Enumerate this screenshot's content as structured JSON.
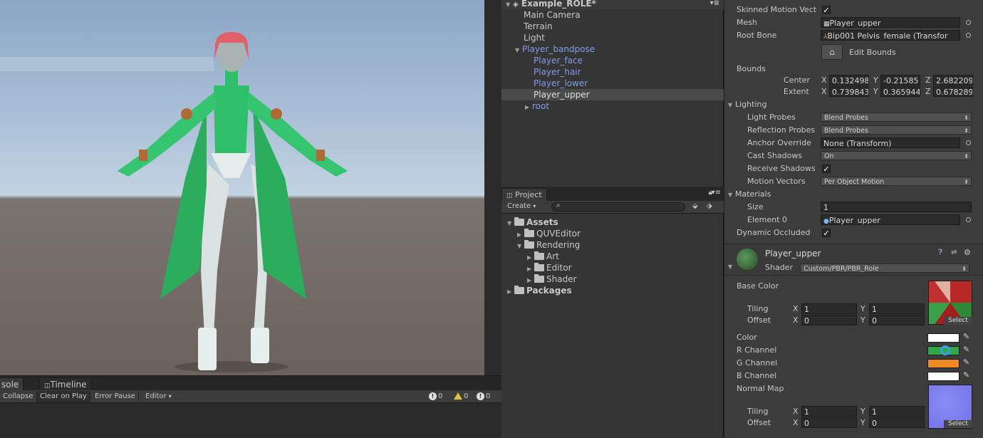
{
  "console": {
    "tab_console": "sole",
    "tab_timeline": "Timeline",
    "btn_collapse": "Collapse",
    "btn_clear_on_play": "Clear on Play",
    "btn_error_pause": "Error Pause",
    "btn_editor": "Editor",
    "count_info": "0",
    "count_warn": "0",
    "count_error": "0"
  },
  "hierarchy": {
    "scene_name": "Example_ROLE*",
    "items": [
      "Main Camera",
      "Terrain",
      "Light",
      "Player_bandpose",
      "Player_face",
      "Player_hair",
      "Player_lower",
      "Player_upper",
      "root"
    ]
  },
  "project": {
    "tab": "Project",
    "create_label": "Create",
    "tree": [
      "Assets",
      "QUVEditor",
      "Rendering",
      "Art",
      "Editor",
      "Shader",
      "Packages"
    ]
  },
  "inspector": {
    "skinned_motion": "Skinned Motion Vect",
    "mesh_label": "Mesh",
    "mesh_value": "Player_upper",
    "root_bone_label": "Root Bone",
    "root_bone_value": "Bip001 Pelvis_female (Transfor",
    "edit_bounds": "Edit Bounds",
    "bounds": "Bounds",
    "center": "Center",
    "center_x": "0.132498",
    "center_y": "-0.21585",
    "center_z": "2.682209",
    "extent": "Extent",
    "extent_x": "0.739843",
    "extent_y": "0.365944",
    "extent_z": "0.678289",
    "ax_x": "X",
    "ax_y": "Y",
    "ax_z": "Z",
    "lighting": "Lighting",
    "light_probes_label": "Light Probes",
    "light_probes_value": "Blend Probes",
    "reflection_probes_label": "Reflection Probes",
    "reflection_probes_value": "Blend Probes",
    "anchor_override_label": "Anchor Override",
    "anchor_override_value": "None (Transform)",
    "cast_shadows_label": "Cast Shadows",
    "cast_shadows_value": "On",
    "receive_shadows_label": "Receive Shadows",
    "motion_vectors_label": "Motion Vectors",
    "motion_vectors_value": "Per Object Motion",
    "materials": "Materials",
    "size_label": "Size",
    "size_value": "1",
    "element0_label": "Element 0",
    "element0_value": "Player_upper",
    "dynamic_occluded": "Dynamic Occluded",
    "material_name": "Player_upper",
    "shader_label": "Shader",
    "shader_value": "Custom/PBR/PBR_Role",
    "base_color": "Base Color",
    "tiling": "Tiling",
    "offset": "Offset",
    "tiling_x": "1",
    "tiling_y": "1",
    "offset_x": "0",
    "offset_y": "0",
    "select": "Select",
    "color": "Color",
    "r_channel": "R Channel",
    "g_channel": "G Channel",
    "b_channel": "B Channel",
    "normal_map": "Normal Map",
    "tiling2_x": "1",
    "tiling2_y": "1",
    "offset2_x": "0",
    "offset2_y": "0"
  },
  "colors": {
    "color_white": "#ffffff",
    "r_channel": "#2ea84a",
    "g_channel": "#f08a24",
    "b_channel": "#ffffff"
  }
}
